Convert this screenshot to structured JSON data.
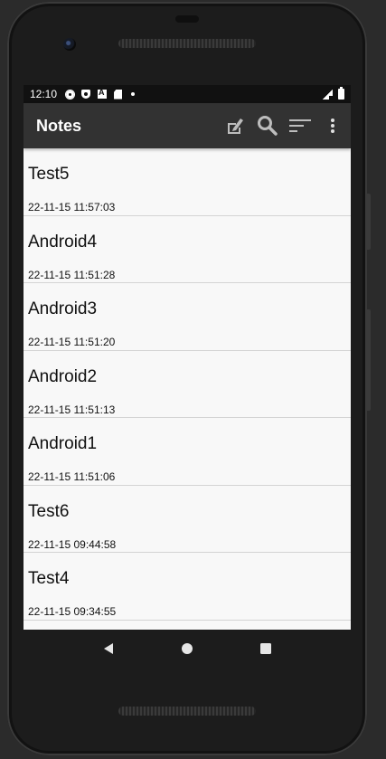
{
  "status_bar": {
    "time": "12:10",
    "icons": [
      "gear-icon",
      "shield-icon",
      "font-icon",
      "sd-card-icon",
      "dot-icon"
    ],
    "right_icons": [
      "signal-icon",
      "battery-icon"
    ]
  },
  "app_bar": {
    "title": "Notes",
    "actions": [
      "edit-note-icon",
      "search-icon",
      "sort-icon",
      "more-vert-icon"
    ],
    "background": "#323232"
  },
  "notes": [
    {
      "title": "Test5",
      "date": "22-11-15 11:57:03"
    },
    {
      "title": "Android4",
      "date": "22-11-15 11:51:28"
    },
    {
      "title": "Android3",
      "date": "22-11-15 11:51:20"
    },
    {
      "title": "Android2",
      "date": "22-11-15 11:51:13"
    },
    {
      "title": "Android1",
      "date": "22-11-15 11:51:06"
    },
    {
      "title": "Test6",
      "date": "22-11-15 09:44:58"
    },
    {
      "title": "Test4",
      "date": "22-11-15 09:34:55"
    }
  ],
  "nav_bar": {
    "buttons": [
      "back-icon",
      "home-icon",
      "recents-icon"
    ]
  }
}
